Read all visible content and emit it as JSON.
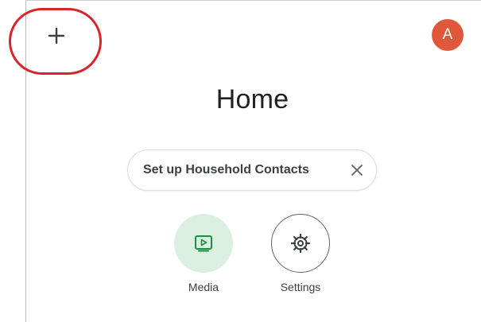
{
  "header": {
    "add_icon": "plus-icon",
    "avatar_initial": "A",
    "avatar_color": "#e0583a"
  },
  "annotation": {
    "callout_color": "#d8252b"
  },
  "main": {
    "title": "Home",
    "chip": {
      "label": "Set up Household Contacts",
      "close_icon": "close-icon"
    },
    "actions": [
      {
        "label": "Media",
        "icon": "play-icon",
        "background": "#dbeee2"
      },
      {
        "label": "Settings",
        "icon": "gear-icon",
        "background": "#ffffff"
      }
    ]
  }
}
